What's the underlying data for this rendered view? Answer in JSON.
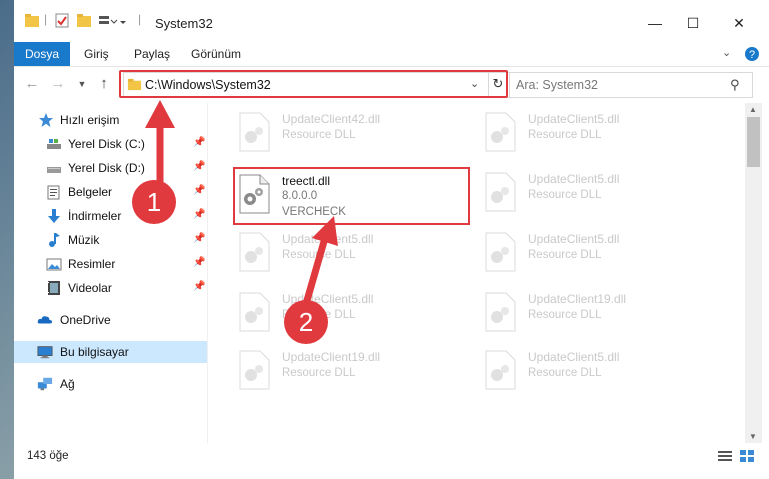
{
  "window": {
    "title": "System32"
  },
  "ribbon": {
    "tabs": [
      "Dosya",
      "Giriş",
      "Paylaş",
      "Görünüm"
    ]
  },
  "address": {
    "path": "C:\\Windows\\System32",
    "search_placeholder": "Ara: System32"
  },
  "sidebar": {
    "items": [
      {
        "label": "Hızlı erişim",
        "icon": "star-icon",
        "pinned": false
      },
      {
        "label": "Yerel Disk (C:)",
        "icon": "drive-icon",
        "pinned": true
      },
      {
        "label": "Yerel Disk (D:)",
        "icon": "drive-icon",
        "pinned": true
      },
      {
        "label": "Belgeler",
        "icon": "documents-icon",
        "pinned": true
      },
      {
        "label": "İndirmeler",
        "icon": "download-icon",
        "pinned": true
      },
      {
        "label": "Müzik",
        "icon": "music-icon",
        "pinned": true
      },
      {
        "label": "Resimler",
        "icon": "pictures-icon",
        "pinned": true
      },
      {
        "label": "Videolar",
        "icon": "videos-icon",
        "pinned": true
      },
      {
        "label": "OneDrive",
        "icon": "cloud-icon",
        "pinned": false
      },
      {
        "label": "Bu bilgisayar",
        "icon": "computer-icon",
        "pinned": false
      },
      {
        "label": "Ağ",
        "icon": "network-icon",
        "pinned": false
      }
    ]
  },
  "files": {
    "highlighted": {
      "name": "treectl.dll",
      "version": "8.0.0.0",
      "company": "VERCHECK"
    },
    "faded": [
      {
        "name": "UpdateClient42.dll",
        "desc": "Resource DLL"
      },
      {
        "name": "UpdateClient5.dll",
        "desc": "Resource DLL"
      },
      {
        "name": "UpdateClient5.dll",
        "desc": "Resource DLL"
      },
      {
        "name": "UpdateClient5.dll",
        "desc": "Resource DLL"
      },
      {
        "name": "UpdateClient5.dll",
        "desc": "Resource DLL"
      },
      {
        "name": "UpdateClient5.dll",
        "desc": "Resource DLL"
      },
      {
        "name": "UpdateClient19.dll",
        "desc": "Resource DLL"
      },
      {
        "name": "UpdateClient19.dll",
        "desc": "Resource DLL"
      },
      {
        "name": "UpdateClient5.dll",
        "desc": "Resource DLL"
      }
    ]
  },
  "status": {
    "count_text": "143 öğe"
  },
  "annotations": {
    "step1": "1",
    "step2": "2"
  },
  "colors": {
    "accent": "#1979ca",
    "highlight": "#e0393e",
    "selection": "#cce8ff"
  }
}
